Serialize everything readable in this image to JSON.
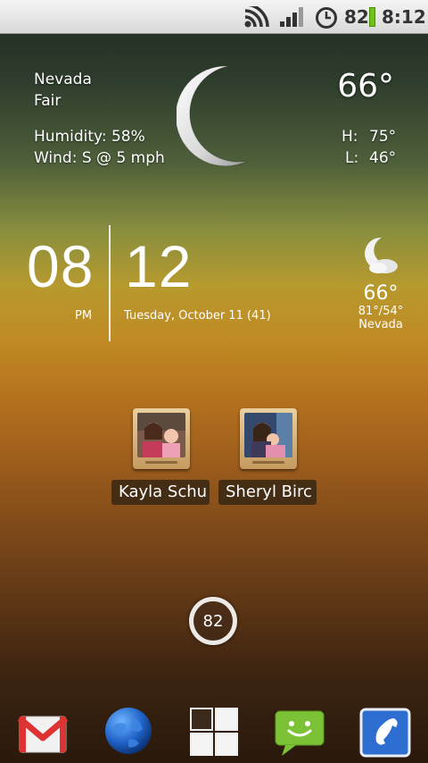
{
  "status_bar": {
    "battery_percent": "82",
    "time": "8:12",
    "icons": [
      "wifi-icon",
      "signal-icon",
      "alarm-icon",
      "battery-icon"
    ]
  },
  "weather_widget": {
    "location": "Nevada",
    "condition": "Fair",
    "humidity": "Humidity: 58%",
    "wind": "Wind: S @ 5 mph",
    "temperature": "66°",
    "high_label": "H:",
    "high_value": "75°",
    "low_label": "L:",
    "low_value": "46°",
    "icon": "moon-icon"
  },
  "clock_widget": {
    "hour": "08",
    "minute": "12",
    "ampm": "PM",
    "date": "Tuesday, October 11 (41)"
  },
  "mini_weather": {
    "icon": "moon-cloud-icon",
    "temperature": "66°",
    "range": "81°/54°",
    "location": "Nevada"
  },
  "contacts": [
    {
      "name": "Kayla Schu"
    },
    {
      "name": "Sheryl Birc"
    }
  ],
  "battery_widget": {
    "value": "82"
  },
  "dock": {
    "items": [
      "gmail-icon",
      "browser-globe-icon",
      "app-drawer-icon",
      "messaging-icon",
      "phone-icon"
    ]
  }
}
